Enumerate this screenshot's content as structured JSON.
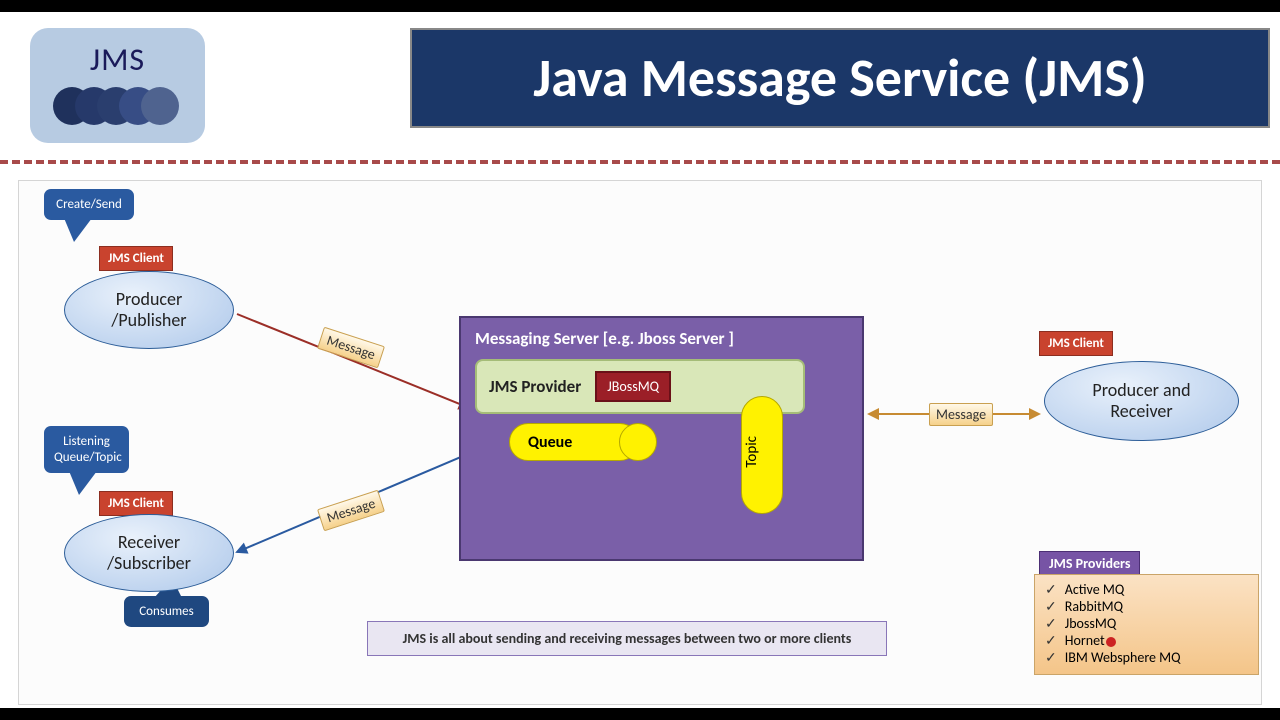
{
  "logo": {
    "text": "JMS"
  },
  "title": "Java Message Service (JMS)",
  "callouts": {
    "create": "Create/Send",
    "listening": "Listening Queue/Topic",
    "consumes": "Consumes"
  },
  "tags": {
    "client1": "JMS Client",
    "client2": "JMS Client",
    "client3": "JMS Client"
  },
  "nodes": {
    "producer_line1": "Producer",
    "producer_line2": "/Publisher",
    "receiver_line1": "Receiver",
    "receiver_line2": "/Subscriber",
    "prodrecv_line1": "Producer and",
    "prodrecv_line2": "Receiver"
  },
  "server": {
    "title": "Messaging Server  [e.g. Jboss Server ]",
    "provider_label": "JMS Provider",
    "provider_impl": "JBossMQ",
    "queue": "Queue",
    "topic": "Topic"
  },
  "messages": {
    "m1": "Message",
    "m2": "Message",
    "m3": "Message"
  },
  "summary": "JMS is all about sending and receiving messages between two or more clients",
  "providers": {
    "title": "JMS Providers",
    "items": [
      "Active MQ",
      "RabbitMQ",
      "JbossMQ",
      "Hornet",
      "IBM Websphere MQ"
    ]
  }
}
